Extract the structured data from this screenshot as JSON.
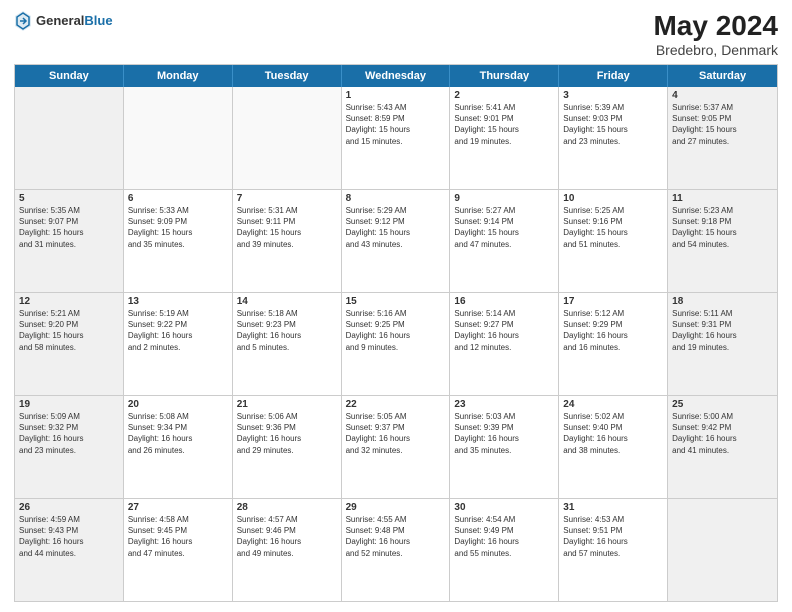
{
  "header": {
    "logo_line1": "General",
    "logo_line2": "Blue",
    "month_title": "May 2024",
    "location": "Bredebro, Denmark"
  },
  "day_headers": [
    "Sunday",
    "Monday",
    "Tuesday",
    "Wednesday",
    "Thursday",
    "Friday",
    "Saturday"
  ],
  "weeks": [
    [
      {
        "num": "",
        "info": "",
        "empty": true
      },
      {
        "num": "",
        "info": "",
        "empty": true
      },
      {
        "num": "",
        "info": "",
        "empty": true
      },
      {
        "num": "1",
        "info": "Sunrise: 5:43 AM\nSunset: 8:59 PM\nDaylight: 15 hours\nand 15 minutes.",
        "empty": false
      },
      {
        "num": "2",
        "info": "Sunrise: 5:41 AM\nSunset: 9:01 PM\nDaylight: 15 hours\nand 19 minutes.",
        "empty": false
      },
      {
        "num": "3",
        "info": "Sunrise: 5:39 AM\nSunset: 9:03 PM\nDaylight: 15 hours\nand 23 minutes.",
        "empty": false
      },
      {
        "num": "4",
        "info": "Sunrise: 5:37 AM\nSunset: 9:05 PM\nDaylight: 15 hours\nand 27 minutes.",
        "empty": false
      }
    ],
    [
      {
        "num": "5",
        "info": "Sunrise: 5:35 AM\nSunset: 9:07 PM\nDaylight: 15 hours\nand 31 minutes.",
        "empty": false
      },
      {
        "num": "6",
        "info": "Sunrise: 5:33 AM\nSunset: 9:09 PM\nDaylight: 15 hours\nand 35 minutes.",
        "empty": false
      },
      {
        "num": "7",
        "info": "Sunrise: 5:31 AM\nSunset: 9:11 PM\nDaylight: 15 hours\nand 39 minutes.",
        "empty": false
      },
      {
        "num": "8",
        "info": "Sunrise: 5:29 AM\nSunset: 9:12 PM\nDaylight: 15 hours\nand 43 minutes.",
        "empty": false
      },
      {
        "num": "9",
        "info": "Sunrise: 5:27 AM\nSunset: 9:14 PM\nDaylight: 15 hours\nand 47 minutes.",
        "empty": false
      },
      {
        "num": "10",
        "info": "Sunrise: 5:25 AM\nSunset: 9:16 PM\nDaylight: 15 hours\nand 51 minutes.",
        "empty": false
      },
      {
        "num": "11",
        "info": "Sunrise: 5:23 AM\nSunset: 9:18 PM\nDaylight: 15 hours\nand 54 minutes.",
        "empty": false
      }
    ],
    [
      {
        "num": "12",
        "info": "Sunrise: 5:21 AM\nSunset: 9:20 PM\nDaylight: 15 hours\nand 58 minutes.",
        "empty": false
      },
      {
        "num": "13",
        "info": "Sunrise: 5:19 AM\nSunset: 9:22 PM\nDaylight: 16 hours\nand 2 minutes.",
        "empty": false
      },
      {
        "num": "14",
        "info": "Sunrise: 5:18 AM\nSunset: 9:23 PM\nDaylight: 16 hours\nand 5 minutes.",
        "empty": false
      },
      {
        "num": "15",
        "info": "Sunrise: 5:16 AM\nSunset: 9:25 PM\nDaylight: 16 hours\nand 9 minutes.",
        "empty": false
      },
      {
        "num": "16",
        "info": "Sunrise: 5:14 AM\nSunset: 9:27 PM\nDaylight: 16 hours\nand 12 minutes.",
        "empty": false
      },
      {
        "num": "17",
        "info": "Sunrise: 5:12 AM\nSunset: 9:29 PM\nDaylight: 16 hours\nand 16 minutes.",
        "empty": false
      },
      {
        "num": "18",
        "info": "Sunrise: 5:11 AM\nSunset: 9:31 PM\nDaylight: 16 hours\nand 19 minutes.",
        "empty": false
      }
    ],
    [
      {
        "num": "19",
        "info": "Sunrise: 5:09 AM\nSunset: 9:32 PM\nDaylight: 16 hours\nand 23 minutes.",
        "empty": false
      },
      {
        "num": "20",
        "info": "Sunrise: 5:08 AM\nSunset: 9:34 PM\nDaylight: 16 hours\nand 26 minutes.",
        "empty": false
      },
      {
        "num": "21",
        "info": "Sunrise: 5:06 AM\nSunset: 9:36 PM\nDaylight: 16 hours\nand 29 minutes.",
        "empty": false
      },
      {
        "num": "22",
        "info": "Sunrise: 5:05 AM\nSunset: 9:37 PM\nDaylight: 16 hours\nand 32 minutes.",
        "empty": false
      },
      {
        "num": "23",
        "info": "Sunrise: 5:03 AM\nSunset: 9:39 PM\nDaylight: 16 hours\nand 35 minutes.",
        "empty": false
      },
      {
        "num": "24",
        "info": "Sunrise: 5:02 AM\nSunset: 9:40 PM\nDaylight: 16 hours\nand 38 minutes.",
        "empty": false
      },
      {
        "num": "25",
        "info": "Sunrise: 5:00 AM\nSunset: 9:42 PM\nDaylight: 16 hours\nand 41 minutes.",
        "empty": false
      }
    ],
    [
      {
        "num": "26",
        "info": "Sunrise: 4:59 AM\nSunset: 9:43 PM\nDaylight: 16 hours\nand 44 minutes.",
        "empty": false
      },
      {
        "num": "27",
        "info": "Sunrise: 4:58 AM\nSunset: 9:45 PM\nDaylight: 16 hours\nand 47 minutes.",
        "empty": false
      },
      {
        "num": "28",
        "info": "Sunrise: 4:57 AM\nSunset: 9:46 PM\nDaylight: 16 hours\nand 49 minutes.",
        "empty": false
      },
      {
        "num": "29",
        "info": "Sunrise: 4:55 AM\nSunset: 9:48 PM\nDaylight: 16 hours\nand 52 minutes.",
        "empty": false
      },
      {
        "num": "30",
        "info": "Sunrise: 4:54 AM\nSunset: 9:49 PM\nDaylight: 16 hours\nand 55 minutes.",
        "empty": false
      },
      {
        "num": "31",
        "info": "Sunrise: 4:53 AM\nSunset: 9:51 PM\nDaylight: 16 hours\nand 57 minutes.",
        "empty": false
      },
      {
        "num": "",
        "info": "",
        "empty": true
      }
    ]
  ]
}
